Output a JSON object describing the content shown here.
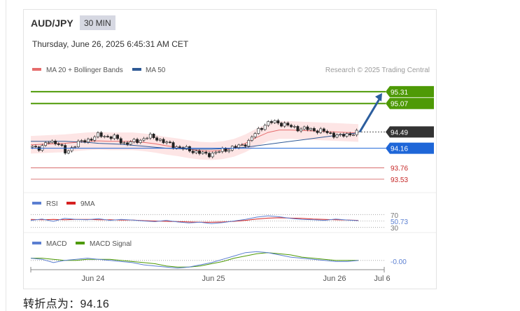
{
  "header": {
    "pair": "AUD/JPY",
    "timeframe": "30 MIN",
    "timestamp": "Thursday, June 26, 2025 6:45:31 AM CET"
  },
  "legend": {
    "ma20": "MA 20 + Bollinger Bands",
    "ma50": "MA 50",
    "credit": "Research © 2025 Trading Central"
  },
  "colors": {
    "ma20": "#e66c6c",
    "ma50": "#2f5a96",
    "band_fill": "#fde0e0",
    "up_target": "#4e9a06",
    "pivot": "#1e66d8",
    "support": "#c62828",
    "price_tag": "#333333",
    "arrow": "#2c5e9e",
    "rsi": "#5b7fd1",
    "rsi_ma": "#d62020",
    "macd": "#5b7fd1",
    "macd_signal": "#4e9a06"
  },
  "chart_data": {
    "type": "candlestick",
    "instrument": "AUD/JPY",
    "interval": "30 MIN",
    "x_ticks": [
      "Jun 24",
      "Jun 25",
      "Jun 26",
      "Jul 6"
    ],
    "ylim": [
      93.4,
      95.45
    ],
    "last_price": 94.49,
    "levels": [
      {
        "value": 95.31,
        "label": "95.31",
        "role": "resistance"
      },
      {
        "value": 95.07,
        "label": "95.07",
        "role": "resistance"
      },
      {
        "value": 94.49,
        "label": "94.49",
        "role": "last"
      },
      {
        "value": 94.16,
        "label": "94.16",
        "role": "pivot"
      },
      {
        "value": 93.76,
        "label": "93.76",
        "role": "support"
      },
      {
        "value": 93.53,
        "label": "93.53",
        "role": "support"
      }
    ],
    "projection": {
      "from": 94.49,
      "to": 95.31
    },
    "price_path": [
      94.2,
      94.16,
      94.3,
      94.28,
      94.06,
      94.22,
      94.3,
      94.35,
      94.43,
      94.4,
      94.37,
      94.26,
      94.28,
      94.33,
      94.4,
      94.36,
      94.27,
      94.21,
      94.16,
      94.12,
      94.07,
      94.03,
      94.07,
      94.12,
      94.17,
      94.2,
      94.3,
      94.5,
      94.65,
      94.7,
      94.66,
      94.6,
      94.56,
      94.55,
      94.53,
      94.5,
      94.45,
      94.4,
      94.45,
      94.47
    ],
    "ma20": [
      94.23,
      94.24,
      94.25,
      94.26,
      94.28,
      94.3,
      94.31,
      94.3,
      94.3,
      94.3,
      94.28,
      94.25,
      94.21,
      94.18,
      94.14,
      94.11,
      94.1,
      94.12,
      94.17,
      94.26,
      94.38,
      94.48,
      94.53,
      94.53,
      94.52,
      94.51,
      94.5,
      94.49,
      94.48,
      94.47
    ],
    "ma50": [
      94.3,
      94.3,
      94.3,
      94.3,
      94.29,
      94.28,
      94.26,
      94.25,
      94.24,
      94.22,
      94.2,
      94.18,
      94.16,
      94.15,
      94.14,
      94.14,
      94.14,
      94.15,
      94.16,
      94.18,
      94.21,
      94.24,
      94.27,
      94.3,
      94.33,
      94.36,
      94.39,
      94.42,
      94.45,
      94.47
    ],
    "indicators": {
      "rsi": {
        "label": "RSI",
        "ma_label": "9MA",
        "levels": [
          "70",
          "50.73",
          "30"
        ],
        "value": 50.73,
        "values": [
          52,
          56,
          49,
          58,
          55,
          54,
          57,
          52,
          55,
          53,
          50,
          48,
          52,
          47,
          44,
          46,
          42,
          45,
          50,
          55,
          62,
          66,
          63,
          58,
          55,
          54,
          52,
          56,
          53,
          51
        ],
        "ma_values": [
          55,
          54,
          55,
          54,
          55,
          55,
          54,
          54,
          53,
          53,
          51,
          50,
          49,
          48,
          47,
          46,
          46,
          47,
          49,
          52,
          56,
          59,
          60,
          59,
          58,
          56,
          55,
          54,
          53,
          52
        ]
      },
      "macd": {
        "label": "MACD",
        "signal_label": "MACD Signal",
        "value_label": "-0.00",
        "values": [
          0.02,
          0.01,
          -0.02,
          0.0,
          0.01,
          0.02,
          0.01,
          0.0,
          -0.01,
          -0.02,
          -0.04,
          -0.05,
          -0.06,
          -0.07,
          -0.06,
          -0.04,
          -0.02,
          0.01,
          0.04,
          0.07,
          0.08,
          0.07,
          0.05,
          0.03,
          0.02,
          0.01,
          0.0,
          -0.01,
          -0.01,
          0.0
        ],
        "signal_values": [
          0.02,
          0.02,
          0.01,
          0.0,
          0.0,
          0.01,
          0.01,
          0.01,
          0.0,
          -0.01,
          -0.02,
          -0.03,
          -0.05,
          -0.06,
          -0.06,
          -0.05,
          -0.03,
          -0.01,
          0.02,
          0.04,
          0.06,
          0.07,
          0.06,
          0.05,
          0.03,
          0.02,
          0.01,
          0.0,
          0.0,
          0.0
        ]
      }
    }
  },
  "footer": {
    "pivot_text": "转折点为：94.16"
  }
}
